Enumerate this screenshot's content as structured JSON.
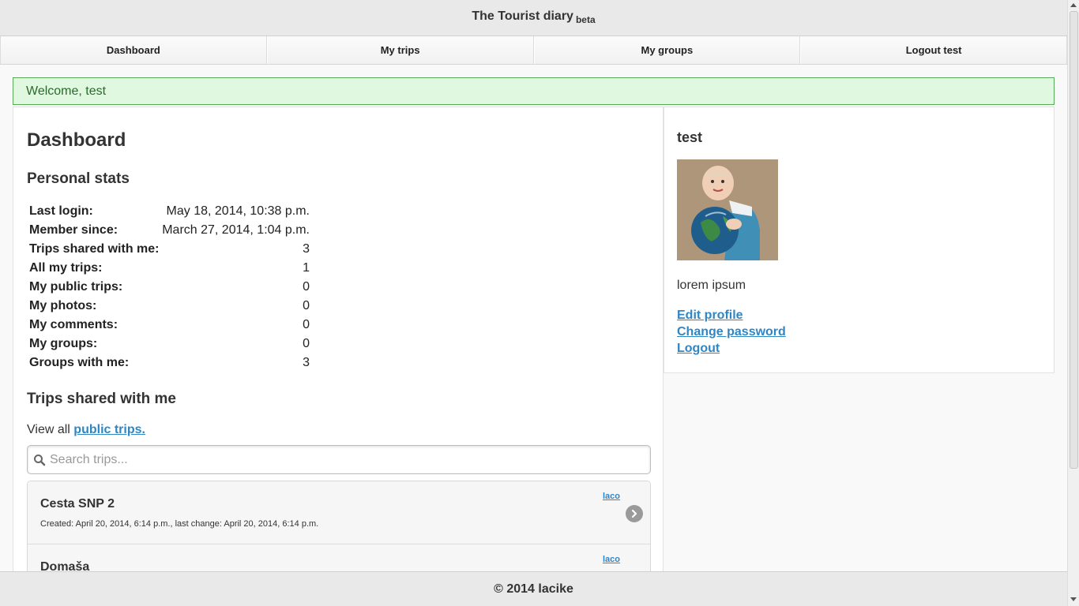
{
  "header": {
    "title": "The Tourist diary",
    "badge": "beta"
  },
  "nav": {
    "items": [
      {
        "label": "Dashboard"
      },
      {
        "label": "My trips"
      },
      {
        "label": "My groups"
      },
      {
        "label": "Logout test"
      }
    ]
  },
  "welcome": {
    "message": "Welcome, test"
  },
  "dashboard": {
    "title": "Dashboard",
    "stats_heading": "Personal stats",
    "stats": [
      {
        "label": "Last login:",
        "value": "May 18, 2014, 10:38 p.m."
      },
      {
        "label": "Member since:",
        "value": "March 27, 2014, 1:04 p.m."
      },
      {
        "label": "Trips shared with me:",
        "value": "3"
      },
      {
        "label": "All my trips:",
        "value": "1"
      },
      {
        "label": "My public trips:",
        "value": "0"
      },
      {
        "label": "My photos:",
        "value": "0"
      },
      {
        "label": "My comments:",
        "value": "0"
      },
      {
        "label": "My groups:",
        "value": "0"
      },
      {
        "label": "Groups with me:",
        "value": "3"
      }
    ],
    "trips_heading": "Trips shared with me",
    "view_all_prefix": "View all",
    "view_all_link": "public trips.",
    "search": {
      "placeholder": "Search trips...",
      "value": ""
    },
    "trips": [
      {
        "name": "Cesta SNP 2",
        "meta": "Created: April 20, 2014, 6:14 p.m., last change: April 20, 2014, 6:14 p.m.",
        "owner": "laco"
      },
      {
        "name": "Domaša",
        "meta": "",
        "owner": "laco"
      }
    ]
  },
  "profile": {
    "username": "test",
    "bio": "lorem ipsum",
    "links": {
      "edit_profile": "Edit profile",
      "change_password": "Change password",
      "logout": "Logout"
    }
  },
  "footer": {
    "text": "© 2014 lacike"
  },
  "colors": {
    "link": "#2f86c5",
    "welcome_bg": "#dff8df",
    "welcome_border": "#5aa95a"
  },
  "icons": {
    "search": "search-icon",
    "trip_arrow": "chevron-right-icon"
  }
}
